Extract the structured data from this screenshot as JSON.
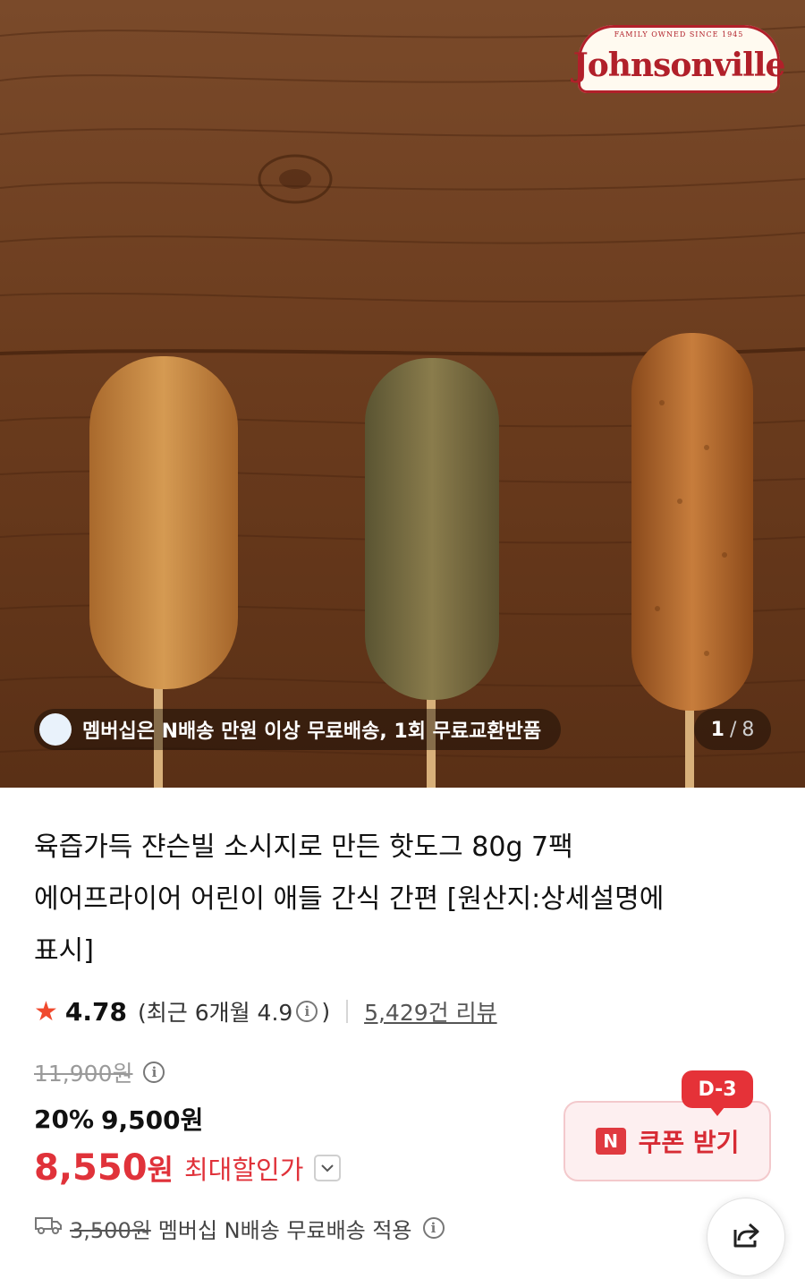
{
  "hero": {
    "brand_logo": "Johnsonville",
    "brand_logo_band": "FAMILY OWNED SINCE 1945",
    "membership_banner": "멤버십은 N배송 만원 이상 무료배송, 1회 무료교환반품",
    "image_counter": {
      "current": "1",
      "separator": "/",
      "total": "8"
    }
  },
  "product": {
    "title_lines": [
      "육즙가득 쟌슨빌 소시지로 만든 핫도그 80g 7팩",
      "에어프라이어 어린이 애들 간식 간편 [원산지:상세설명에",
      "표시]"
    ],
    "rating": {
      "score": "4.78",
      "recent_prefix": "(최근 6개월 4.9",
      "recent_suffix": ")",
      "review_count": "5,429건 리뷰"
    }
  },
  "price": {
    "original": "11,900원",
    "discount_rate": "20%",
    "discounted": "9,500원",
    "final_amount": "8,550",
    "final_unit": "원",
    "final_label": "최대할인가"
  },
  "coupon": {
    "dday": "D-3",
    "n_icon": "N",
    "label": "쿠폰 받기"
  },
  "shipping": {
    "fee": "3,500원",
    "note": "멤버십 N배송 무료배송 적용"
  },
  "icons": {
    "star": "★",
    "info": "i",
    "share": "share-icon",
    "truck": "truck-icon",
    "chevron": "chevron-down-icon"
  },
  "colors": {
    "accent_red": "#e0323a",
    "star": "#f0492d",
    "coupon_bg": "#fdeff0",
    "wood": "#6e3f20"
  }
}
